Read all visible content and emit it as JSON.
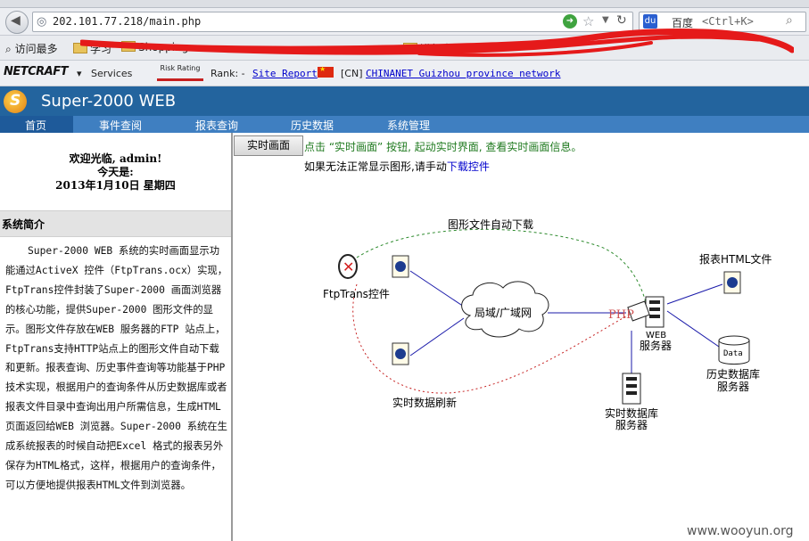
{
  "browser": {
    "url": "202.101.77.218/main.php",
    "search_engine": "百度",
    "search_placeholder": "<Ctrl+K>",
    "bookmarks": [
      {
        "label": "访问最多"
      },
      {
        "label": "学习"
      },
      {
        "label": "Shopping"
      },
      {
        "label": "进行中"
      }
    ],
    "netcraft": {
      "logo": "NETCRAFT",
      "services": "Services",
      "risk_rating": "Risk Rating",
      "rank_label": "Rank: -",
      "site_report": "Site Report",
      "country": "[CN]",
      "network": "CHINANET Guizhou province network"
    }
  },
  "app": {
    "title": "Super-2000 WEB",
    "menu": [
      "首页",
      "事件查阅",
      "报表查询",
      "历史数据",
      "系统管理"
    ],
    "active_menu_index": 0
  },
  "sidebar": {
    "welcome": "欢迎光临, admin!",
    "today_label": "今天是:",
    "date": "2013年1月10日 星期四",
    "section_title": "系统简介",
    "intro_text": "Super-2000 WEB 系统的实时画面显示功能通过ActiveX 控件（FtpTrans.ocx）实现，FtpTrans控件封装了Super-2000 画面浏览器的核心功能，提供Super-2000 图形文件的显示。图形文件存放在WEB 服务器的FTP 站点上，FtpTrans支持HTTP站点上的图形文件自动下载和更新。报表查询、历史事件查询等功能基于PHP 技术实现，根据用户的查询条件从历史数据库或者报表文件目录中查询出用户所需信息，生成HTML 页面返回给WEB 浏览器。Super-2000 系统在生成系统报表的时候自动把Excel 格式的报表另外保存为HTML格式，这样，根据用户的查询条件，可以方便地提供报表HTML文件到浏览器。"
  },
  "main": {
    "realtime_button": "实时画面",
    "hint_line1": "点击 “实时画面” 按钮, 起动实时界面, 查看实时画面信息。",
    "hint_line2_prefix": "如果无法正常显示图形,请手动",
    "hint_line2_link": "下载控件"
  },
  "diagram": {
    "auto_download": "图形文件自动下载",
    "ftptrans": "FtpTrans控件",
    "network": "局域/广域网",
    "php": "PHP",
    "web_server_1": "WEB",
    "web_server_2": "服务器",
    "report_html": "报表HTML文件",
    "data_label": "Data",
    "history_db_1": "历史数据库",
    "history_db_2": "服务器",
    "realtime_refresh": "实时数据刷新",
    "realtime_db_1": "实时数据库",
    "realtime_db_2": "服务器"
  },
  "watermark": "www.wooyun.org",
  "colors": {
    "header_blue": "#23649e",
    "menu_blue": "#3f7fc1",
    "download_dash": "#2e8b2e",
    "refresh_dash": "#c62020",
    "link_line": "#1a1aaa"
  }
}
